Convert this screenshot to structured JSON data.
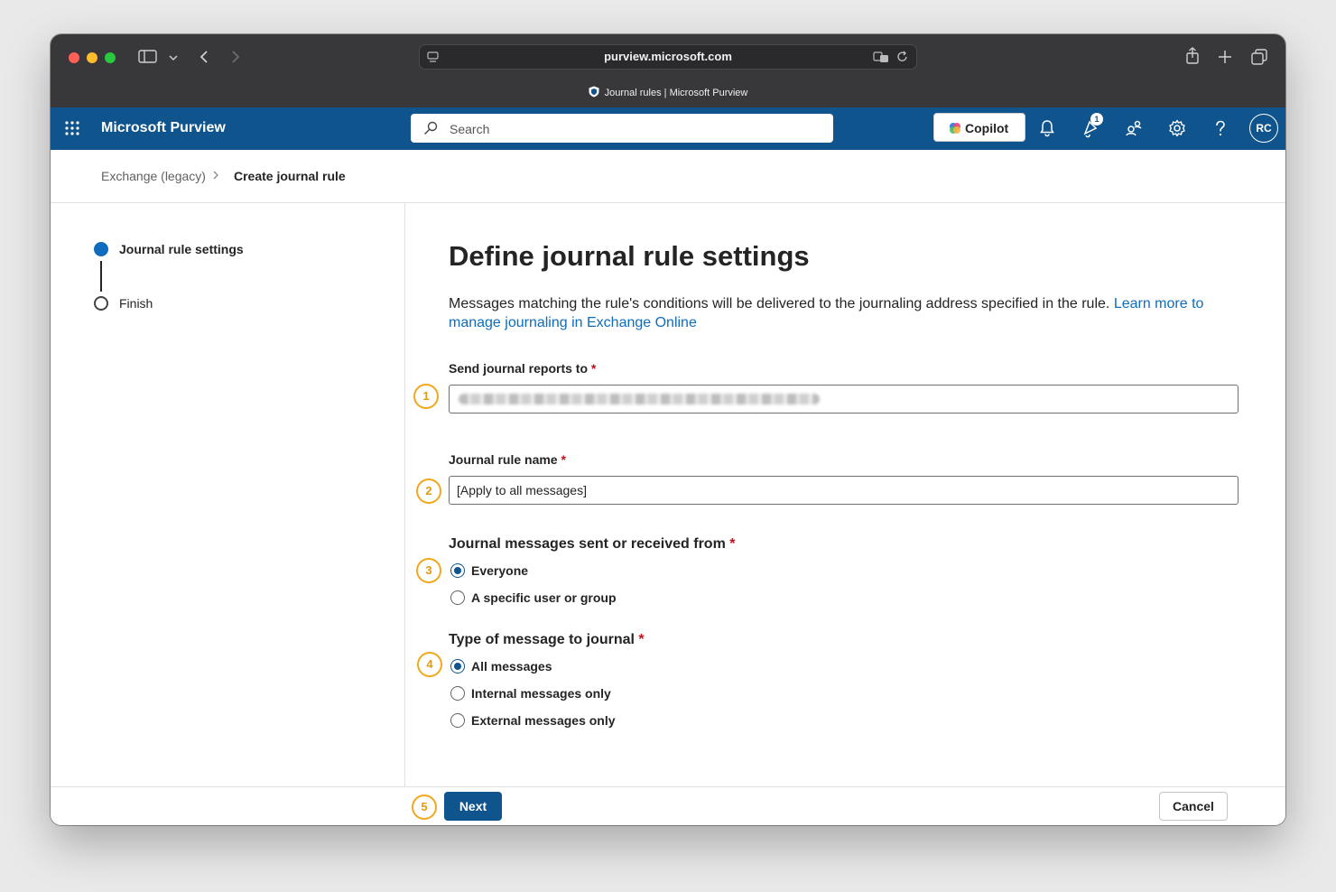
{
  "browser": {
    "url": "purview.microsoft.com",
    "tab_title": "Journal rules | Microsoft Purview"
  },
  "header": {
    "brand": "Microsoft Purview",
    "search_placeholder": "Search",
    "copilot_label": "Copilot",
    "notification_count": "1",
    "avatar_initials": "RC"
  },
  "breadcrumb": {
    "parent": "Exchange (legacy)",
    "current": "Create journal rule"
  },
  "steps": [
    {
      "label": "Journal rule settings",
      "active": true
    },
    {
      "label": "Finish",
      "active": false
    }
  ],
  "main": {
    "title": "Define journal rule settings",
    "description": "Messages matching the rule's conditions will be delivered to the journaling address specified in the rule.",
    "learn_more_link": "Learn more to manage journaling in Exchange Online",
    "send_reports_label": "Send journal reports to",
    "rule_name_label": "Journal rule name",
    "rule_name_value": "[Apply to all messages]",
    "sent_received_label": "Journal messages sent or received from",
    "sent_received_options": [
      {
        "label": "Everyone",
        "selected": true
      },
      {
        "label": "A specific user or group",
        "selected": false
      }
    ],
    "message_type_label": "Type of message to journal",
    "message_type_options": [
      {
        "label": "All messages",
        "selected": true
      },
      {
        "label": "Internal messages only",
        "selected": false
      },
      {
        "label": "External messages only",
        "selected": false
      }
    ],
    "required_mark": "*"
  },
  "annotations": [
    "1",
    "2",
    "3",
    "4",
    "5"
  ],
  "footer": {
    "next_label": "Next",
    "cancel_label": "Cancel"
  },
  "colors": {
    "accent": "#0f548c",
    "link": "#0f6cbd",
    "marker": "#f2a81d",
    "required": "#c50f1f"
  }
}
